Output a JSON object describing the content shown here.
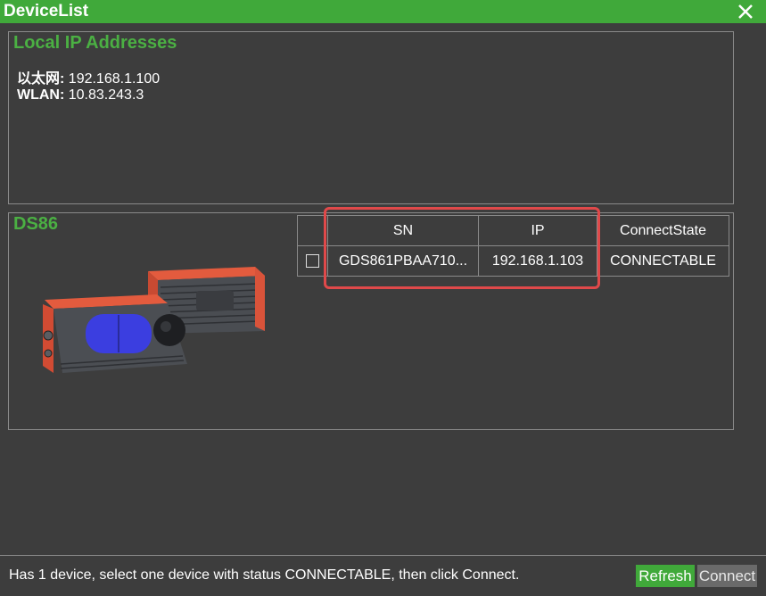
{
  "window": {
    "title": "DeviceList"
  },
  "local_ip": {
    "title": "Local IP Addresses",
    "ethernet_label": "以太网:",
    "ethernet_value": " 192.168.1.100",
    "wlan_label": "WLAN:",
    "wlan_value": " 10.83.243.3"
  },
  "device_group": {
    "title": "DS86"
  },
  "device_table": {
    "headers": {
      "sn": "SN",
      "ip": "IP",
      "state": "ConnectState"
    },
    "rows": [
      {
        "sn": "GDS861PBAA710...",
        "ip": "192.168.1.103",
        "state": "CONNECTABLE"
      }
    ]
  },
  "status": {
    "message": "Has 1 device, select one device with status CONNECTABLE, then click Connect."
  },
  "buttons": {
    "refresh": "Refresh",
    "connect": "Connect"
  },
  "colors": {
    "accent": "#40a93a",
    "highlight": "#e0494a",
    "background": "#3d3d3d"
  }
}
